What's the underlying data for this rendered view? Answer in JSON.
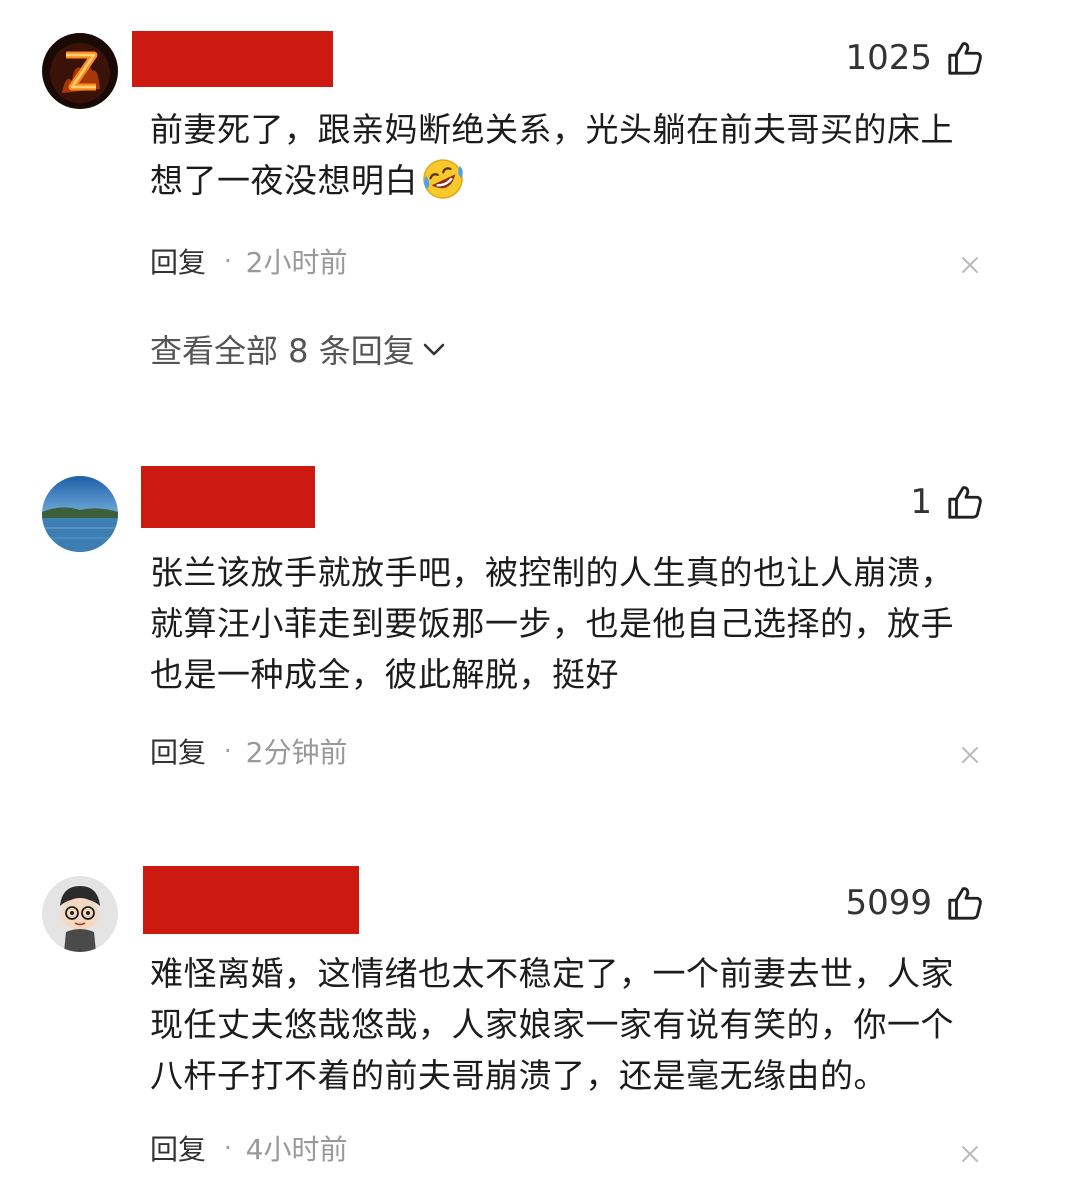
{
  "comments": [
    {
      "likes": "1025",
      "text_line1": "前妻死了，跟亲妈断绝关系，光头躺在前夫哥买的床上",
      "text_line2": "想了一夜没想明白",
      "emoji": "rolling-on-floor-laughing-icon",
      "reply_label": "回复",
      "separator": "·",
      "time": "2小时前",
      "view_replies": "查看全部 8 条回复"
    },
    {
      "likes": "1",
      "text_line1": "张兰该放手就放手吧，被控制的人生真的也让人崩溃，",
      "text_line2": "就算汪小菲走到要饭那一步，也是他自己选择的，放手",
      "text_line3": "也是一种成全，彼此解脱，挺好",
      "reply_label": "回复",
      "separator": "·",
      "time": "2分钟前"
    },
    {
      "likes": "5099",
      "text_line1": "难怪离婚，这情绪也太不稳定了，一个前妻去世，人家",
      "text_line2": "现任丈夫悠哉悠哉，人家娘家一家有说有笑的，你一个",
      "text_line3": "八杆子打不着的前夫哥崩溃了，还是毫无缘由的。",
      "reply_label": "回复",
      "separator": "·",
      "time": "4小时前"
    }
  ],
  "colors": {
    "redaction": "#cc1a10",
    "meta_gray": "#999999",
    "text": "#1c1c1c"
  }
}
